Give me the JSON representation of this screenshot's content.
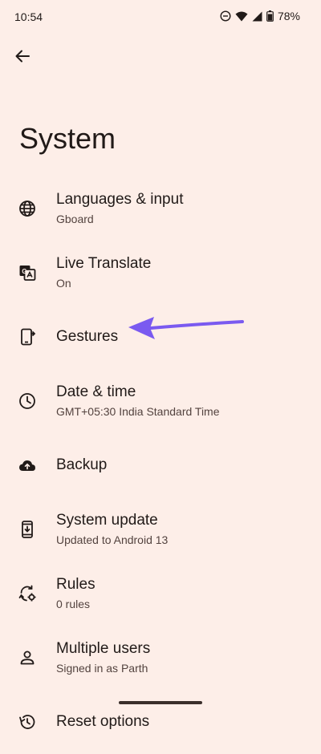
{
  "status_bar": {
    "time": "10:54",
    "battery": "78%",
    "icons": [
      "dnd-icon",
      "wifi-icon",
      "signal-icon",
      "battery-icon"
    ]
  },
  "header": {
    "back_icon": "back-arrow-icon",
    "title": "System"
  },
  "items": [
    {
      "title": "Languages & input",
      "subtitle": "Gboard",
      "icon": "globe-icon"
    },
    {
      "title": "Live Translate",
      "subtitle": "On",
      "icon": "translate-icon"
    },
    {
      "title": "Gestures",
      "subtitle": "",
      "icon": "gestures-icon"
    },
    {
      "title": "Date & time",
      "subtitle": "GMT+05:30 India Standard Time",
      "icon": "clock-icon"
    },
    {
      "title": "Backup",
      "subtitle": "",
      "icon": "cloud-upload-icon"
    },
    {
      "title": "System update",
      "subtitle": "Updated to Android 13",
      "icon": "system-update-icon"
    },
    {
      "title": "Rules",
      "subtitle": "0 rules",
      "icon": "rules-icon"
    },
    {
      "title": "Multiple users",
      "subtitle": "Signed in as Parth",
      "icon": "person-icon"
    },
    {
      "title": "Reset options",
      "subtitle": "",
      "icon": "history-icon"
    }
  ],
  "colors": {
    "background": "#fdeee8",
    "text": "#211a18",
    "subtext": "#53433f",
    "annotation_arrow": "#7a5af0"
  }
}
